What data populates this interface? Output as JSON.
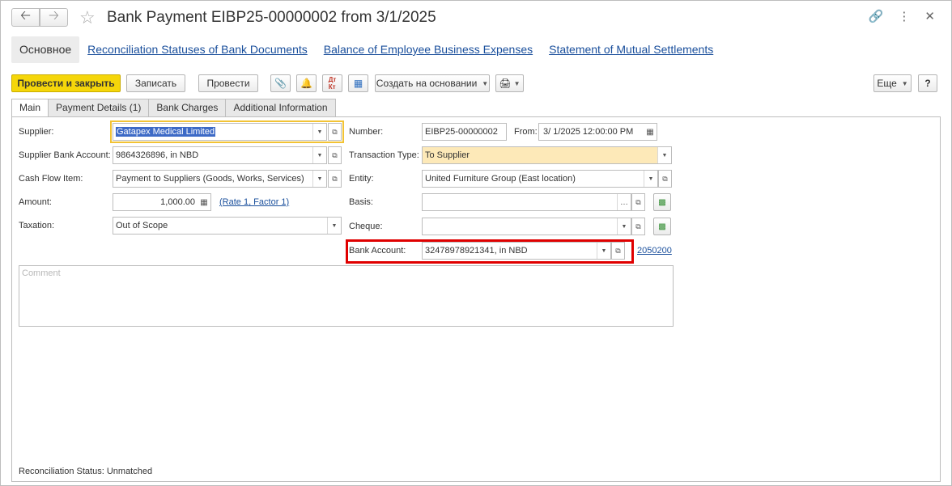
{
  "window": {
    "title": "Bank Payment EIBP25-00000002 from 3/1/2025",
    "back_icon": "arrow-left-icon",
    "forward_icon": "arrow-right-icon",
    "favorite_icon": "star-icon",
    "link_icon": "link-icon",
    "menu_icon": "more-vertical-icon",
    "close_icon": "close-icon"
  },
  "section_tabs": [
    {
      "label": "Основное",
      "active": true
    },
    {
      "label": "Reconciliation Statuses of Bank Documents"
    },
    {
      "label": "Balance of Employee Business Expenses"
    },
    {
      "label": "Statement of Mutual Settlements"
    }
  ],
  "toolbar": {
    "post_close": "Провести и закрыть",
    "save": "Записать",
    "post": "Провести",
    "create_based": "Создать на основании",
    "more": "Еще",
    "help": "?"
  },
  "form_tabs": [
    {
      "label": "Main",
      "active": true
    },
    {
      "label": "Payment Details (1)"
    },
    {
      "label": "Bank Charges"
    },
    {
      "label": "Additional Information"
    }
  ],
  "form": {
    "supplier_label": "Supplier:",
    "supplier_value": "Gatapex Medical Limited",
    "supplier_bank_label": "Supplier Bank Account:",
    "supplier_bank_value": "9864326896, in NBD",
    "cash_flow_label": "Cash Flow Item:",
    "cash_flow_value": "Payment to Suppliers (Goods, Works, Services)",
    "amount_label": "Amount:",
    "amount_value": "1,000.00",
    "rate_link": "(Rate 1, Factor 1)",
    "taxation_label": "Taxation:",
    "taxation_value": "Out of Scope",
    "number_label": "Number:",
    "number_value": "EIBP25-00000002",
    "from_label": "From:",
    "from_value": "3/ 1/2025 12:00:00 PM",
    "transaction_label": "Transaction Type:",
    "transaction_value": "To Supplier",
    "entity_label": "Entity:",
    "entity_value": "United Furniture Group (East location)",
    "basis_label": "Basis:",
    "basis_value": "",
    "cheque_label": "Cheque:",
    "cheque_value": "",
    "bank_account_label": "Bank Account:",
    "bank_account_value": "32478978921341, in NBD",
    "bank_account_link": "2050200",
    "comment_placeholder": "Comment",
    "reconciliation_label": "Reconciliation Status:",
    "reconciliation_value": "Unmatched"
  },
  "colors": {
    "primary_button": "#f5d60a",
    "highlight_field": "#fde9b8",
    "focus_border": "#f2c335",
    "annotation_box": "#e00000",
    "link": "#1a4f9c"
  }
}
